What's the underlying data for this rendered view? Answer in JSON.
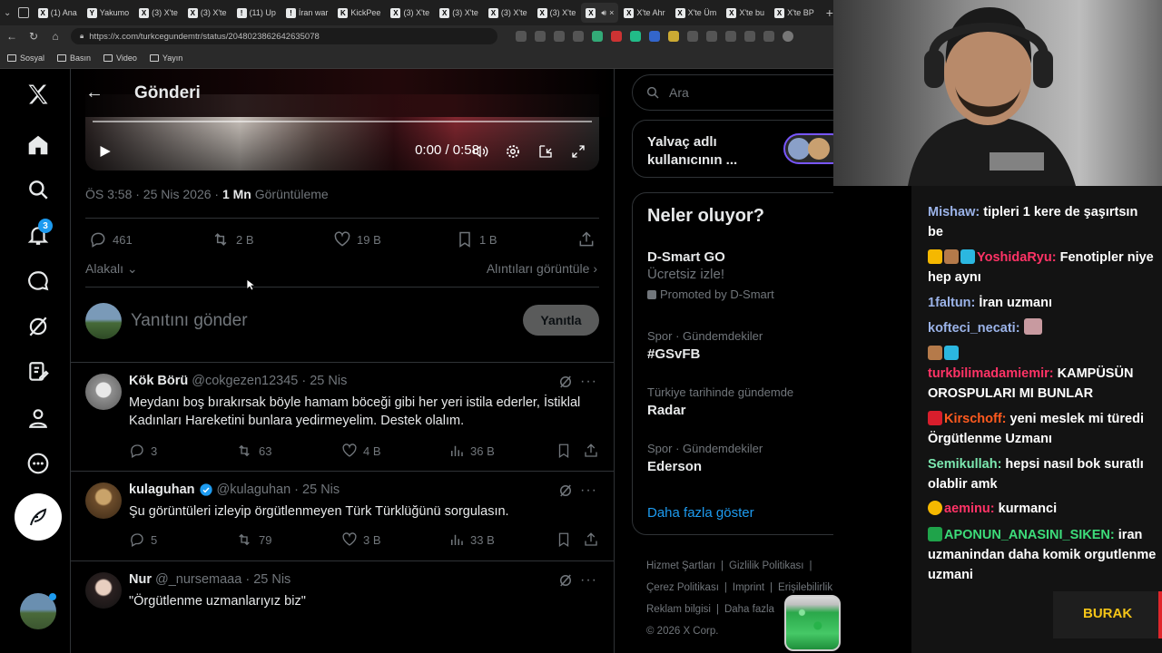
{
  "browser": {
    "tabs": [
      {
        "label": "(1) Ana",
        "fav": "X"
      },
      {
        "label": "Yakumo",
        "fav": "Y"
      },
      {
        "label": "(3) X'te",
        "fav": "X"
      },
      {
        "label": "(3) X'te",
        "fav": "X"
      },
      {
        "label": "(11) Up",
        "fav": "!"
      },
      {
        "label": "İran war",
        "fav": "!"
      },
      {
        "label": "KickPee",
        "fav": "K"
      },
      {
        "label": "(3) X'te",
        "fav": "X"
      },
      {
        "label": "(3) X'te",
        "fav": "X"
      },
      {
        "label": "(3) X'te",
        "fav": "X"
      },
      {
        "label": "(3) X'te",
        "fav": "X"
      },
      {
        "label": "",
        "fav": "X"
      },
      {
        "label": "X'te Ahr",
        "fav": "X"
      },
      {
        "label": "X'te Üm",
        "fav": "X"
      },
      {
        "label": "X'te bu",
        "fav": "X"
      },
      {
        "label": "X'te BP",
        "fav": "X"
      }
    ],
    "url": "https://x.com/turkcegundemtr/status/2048023862642635078",
    "bookmarks": [
      "Sosyal",
      "Basın",
      "Video",
      "Yayın"
    ]
  },
  "x": {
    "header_title": "Gönderi",
    "nav_badge": "3",
    "video": {
      "time": "0:00 / 0:58"
    },
    "meta": {
      "time": "ÖS 3:58 · 25 Nis 2026 · ",
      "views": "1 Mn",
      "views_label": " Görüntüleme"
    },
    "actions": {
      "replies": "461",
      "reposts": "2 B",
      "likes": "19 B",
      "bookmarks": "1 B"
    },
    "relevance": "Alakalı",
    "quotes": "Alıntıları görüntüle",
    "reply_placeholder": "Yanıtını gönder",
    "reply_button": "Yanıtla",
    "tweets": [
      {
        "name": "Kök Börü",
        "handle": "@cokgezen12345 · 25 Nis",
        "text": "Meydanı boş bırakırsak böyle hamam böceği gibi her yeri istila ederler, İstiklal Kadınları Hareketini bunlara yedirmeyelim. Destek olalım.",
        "replies": "3",
        "reposts": "63",
        "likes": "4 B",
        "views": "36 B"
      },
      {
        "name": "kulaguhan",
        "handle": "@kulaguhan · 25 Nis",
        "text": "Şu görüntüleri izleyip örgütlenmeyen Türk Türklüğünü sorgulasın.",
        "replies": "5",
        "reposts": "79",
        "likes": "3 B",
        "views": "33 B"
      },
      {
        "name": "Nur",
        "handle": "@_nursemaaa · 25 Nis",
        "text": "\"Örgütlenme uzmanlarıyız biz\""
      }
    ],
    "search_placeholder": "Ara",
    "suggest": "Yalvaç adlı kullanıcının ...",
    "trends_title": "Neler oluyor?",
    "trends": [
      {
        "ctx": "",
        "title": "D-Smart GO",
        "sub": "Ücretsiz izle!",
        "promo": "Promoted by D-Smart"
      },
      {
        "ctx": "Spor · Gündemdekiler",
        "title": "#GSvFB"
      },
      {
        "ctx": "Türkiye tarihinde gündemde",
        "title": "Radar"
      },
      {
        "ctx": "Spor · Gündemdekiler",
        "title": "Ederson"
      }
    ],
    "show_more": "Daha fazla göster",
    "footer": {
      "l1a": "Hizmet Şartları",
      "l1b": "Gizlilik Politikası",
      "l2a": "Çerez Politikası",
      "l2b": "Imprint",
      "l2c": "Erişilebilirlik",
      "l3a": "Reklam bilgisi",
      "l3b": "Daha fazla",
      "l4": "© 2026 X Corp."
    }
  },
  "chat": [
    {
      "user": "Mishaw",
      "color": "#9bb3e8",
      "text": " tipleri 1 kere de şaşırtsın be"
    },
    {
      "user": "YoshidaRyu",
      "color": "#ff3366",
      "text": " Fenotipler niye hep aynı",
      "badges": 3
    },
    {
      "user": "1faltun",
      "color": "#9bb3e8",
      "text": " İran uzmanı"
    },
    {
      "user": "kofteci_necati",
      "color": "#9bb3e8",
      "text": " ",
      "emote": true
    },
    {
      "user": "turkbilimadamiemir",
      "color": "#ff3366",
      "text": " KAMPÜSÜN OROSPULARI MI BUNLAR",
      "badges": 2
    },
    {
      "user": "Kirschoff",
      "color": "#ff5a1f",
      "text": " yeni meslek mi türedi Örgütlenme Uzmanı",
      "badges": 1
    },
    {
      "user": "Semikullah",
      "color": "#7ce8b0",
      "text": " hepsi nasıl bok suratlı olablir amk"
    },
    {
      "user": "aeminu",
      "color": "#ff3366",
      "text": " kurmanci",
      "badges": 1
    },
    {
      "user": "APONUN_ANASINI_SIKEN",
      "color": "#3ddc7a",
      "text": " iran uzmanindan daha komik orgutlenme uzmani",
      "badges": 1
    }
  ],
  "overlay": {
    "streamer": "BURAK"
  },
  "colors": {
    "accent": "#1d9bf0",
    "bg": "#000000",
    "muted": "#71767b"
  }
}
